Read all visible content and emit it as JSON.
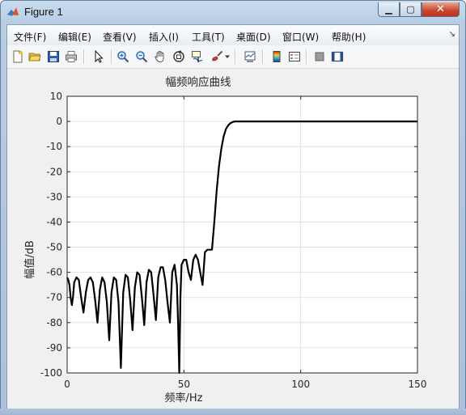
{
  "window": {
    "title": "Figure 1"
  },
  "menu": {
    "items": [
      {
        "label": "文件(F)"
      },
      {
        "label": "编辑(E)"
      },
      {
        "label": "查看(V)"
      },
      {
        "label": "插入(I)"
      },
      {
        "label": "工具(T)"
      },
      {
        "label": "桌面(D)"
      },
      {
        "label": "窗口(W)"
      },
      {
        "label": "帮助(H)"
      }
    ]
  },
  "toolbar": {
    "icons": [
      "new-figure-icon",
      "open-file-icon",
      "save-icon",
      "print-icon",
      "select-pointer-icon",
      "zoom-in-icon",
      "zoom-out-icon",
      "pan-hand-icon",
      "rotate-3d-icon",
      "data-cursor-icon",
      "brush-icon",
      "link-plot-icon",
      "colorbar-icon",
      "legend-icon",
      "hide-plot-tools-icon",
      "show-plot-tools-icon"
    ]
  },
  "colors": {
    "line": "#000000",
    "grid": "#dcdcdc",
    "axes_bg": "#ffffff",
    "figure_bg": "#f0f0f0"
  },
  "chart_data": {
    "type": "line",
    "title": "幅频响应曲线",
    "xlabel": "频率/Hz",
    "ylabel": "幅值/dB",
    "xlim": [
      0,
      150
    ],
    "ylim": [
      -100,
      10
    ],
    "xticks": [
      "0",
      "50",
      "100",
      "150"
    ],
    "yticks": [
      "10",
      "0",
      "-10",
      "-20",
      "-30",
      "-40",
      "-50",
      "-60",
      "-70",
      "-80",
      "-90",
      "-100"
    ],
    "grid": true,
    "series": [
      {
        "x": [
          0,
          0.5,
          1,
          1.5,
          2,
          2.5,
          3,
          4,
          5,
          6,
          7,
          8,
          9,
          10,
          11,
          12,
          13,
          14,
          15,
          16,
          17,
          18,
          19,
          20,
          21,
          22,
          23,
          24,
          25,
          26,
          27,
          28,
          29,
          30,
          31,
          32,
          33,
          34,
          35,
          36,
          37,
          38,
          39,
          40,
          41,
          42,
          43,
          44,
          45,
          46,
          47,
          47.5,
          48,
          48.5,
          49,
          50,
          51,
          52,
          53,
          54,
          55,
          56,
          57,
          58,
          59,
          60,
          61,
          62,
          63,
          64,
          65,
          66,
          67,
          68,
          69,
          70,
          71,
          72,
          73,
          74,
          75,
          76,
          78,
          80,
          85,
          100,
          150
        ],
        "y": [
          -62,
          -63,
          -65,
          -70,
          -73,
          -70,
          -64,
          -62,
          -63,
          -70,
          -76,
          -68,
          -63,
          -62,
          -64,
          -71,
          -80,
          -67,
          -62,
          -64,
          -72,
          -87,
          -68,
          -62,
          -63,
          -72,
          -98,
          -68,
          -61,
          -62,
          -71,
          -83,
          -66,
          -60,
          -61,
          -70,
          -81,
          -64,
          -59,
          -60,
          -69,
          -79,
          -62,
          -58,
          -58,
          -63,
          -72,
          -80,
          -60,
          -57,
          -65,
          -80,
          -100,
          -70,
          -57,
          -55,
          -55,
          -60,
          -63,
          -55,
          -53,
          -55,
          -60,
          -65,
          -52,
          -51,
          -51,
          -51,
          -40,
          -28,
          -18,
          -11,
          -6,
          -3,
          -1.5,
          -0.6,
          -0.2,
          0,
          0,
          0,
          0,
          0,
          0,
          0,
          0,
          0,
          0
        ]
      }
    ]
  }
}
